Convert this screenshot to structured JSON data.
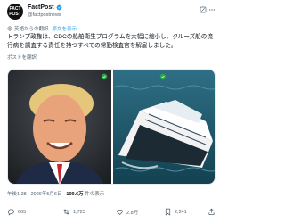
{
  "account": {
    "display_name": "FactPost",
    "handle": "@factpostnews",
    "avatar_text_line1": "FACT",
    "avatar_text_line2": "POST"
  },
  "translation": {
    "label": "英語からの翻訳",
    "link": "原文を表示"
  },
  "post": {
    "text": "トランプ政権は、CDCの船舶衛生プログラムを大幅に縮小し、クルーズ船の流行病を調査する責任を持つすべての常勤検査官を解雇しました。",
    "show_original": "ポストを翻訳"
  },
  "meta": {
    "time": "午後1:38",
    "separator": "·",
    "date": "2026年5月6日",
    "views_count": "109.6万",
    "views_label": "件の表示"
  },
  "actions": {
    "reply_count": "665",
    "repost_count": "1,723",
    "like_count": "2.8万",
    "share_count": "2,241"
  },
  "colors": {
    "accent": "#1d9bf0",
    "muted": "#536471",
    "verified": "#1d9bf0"
  }
}
